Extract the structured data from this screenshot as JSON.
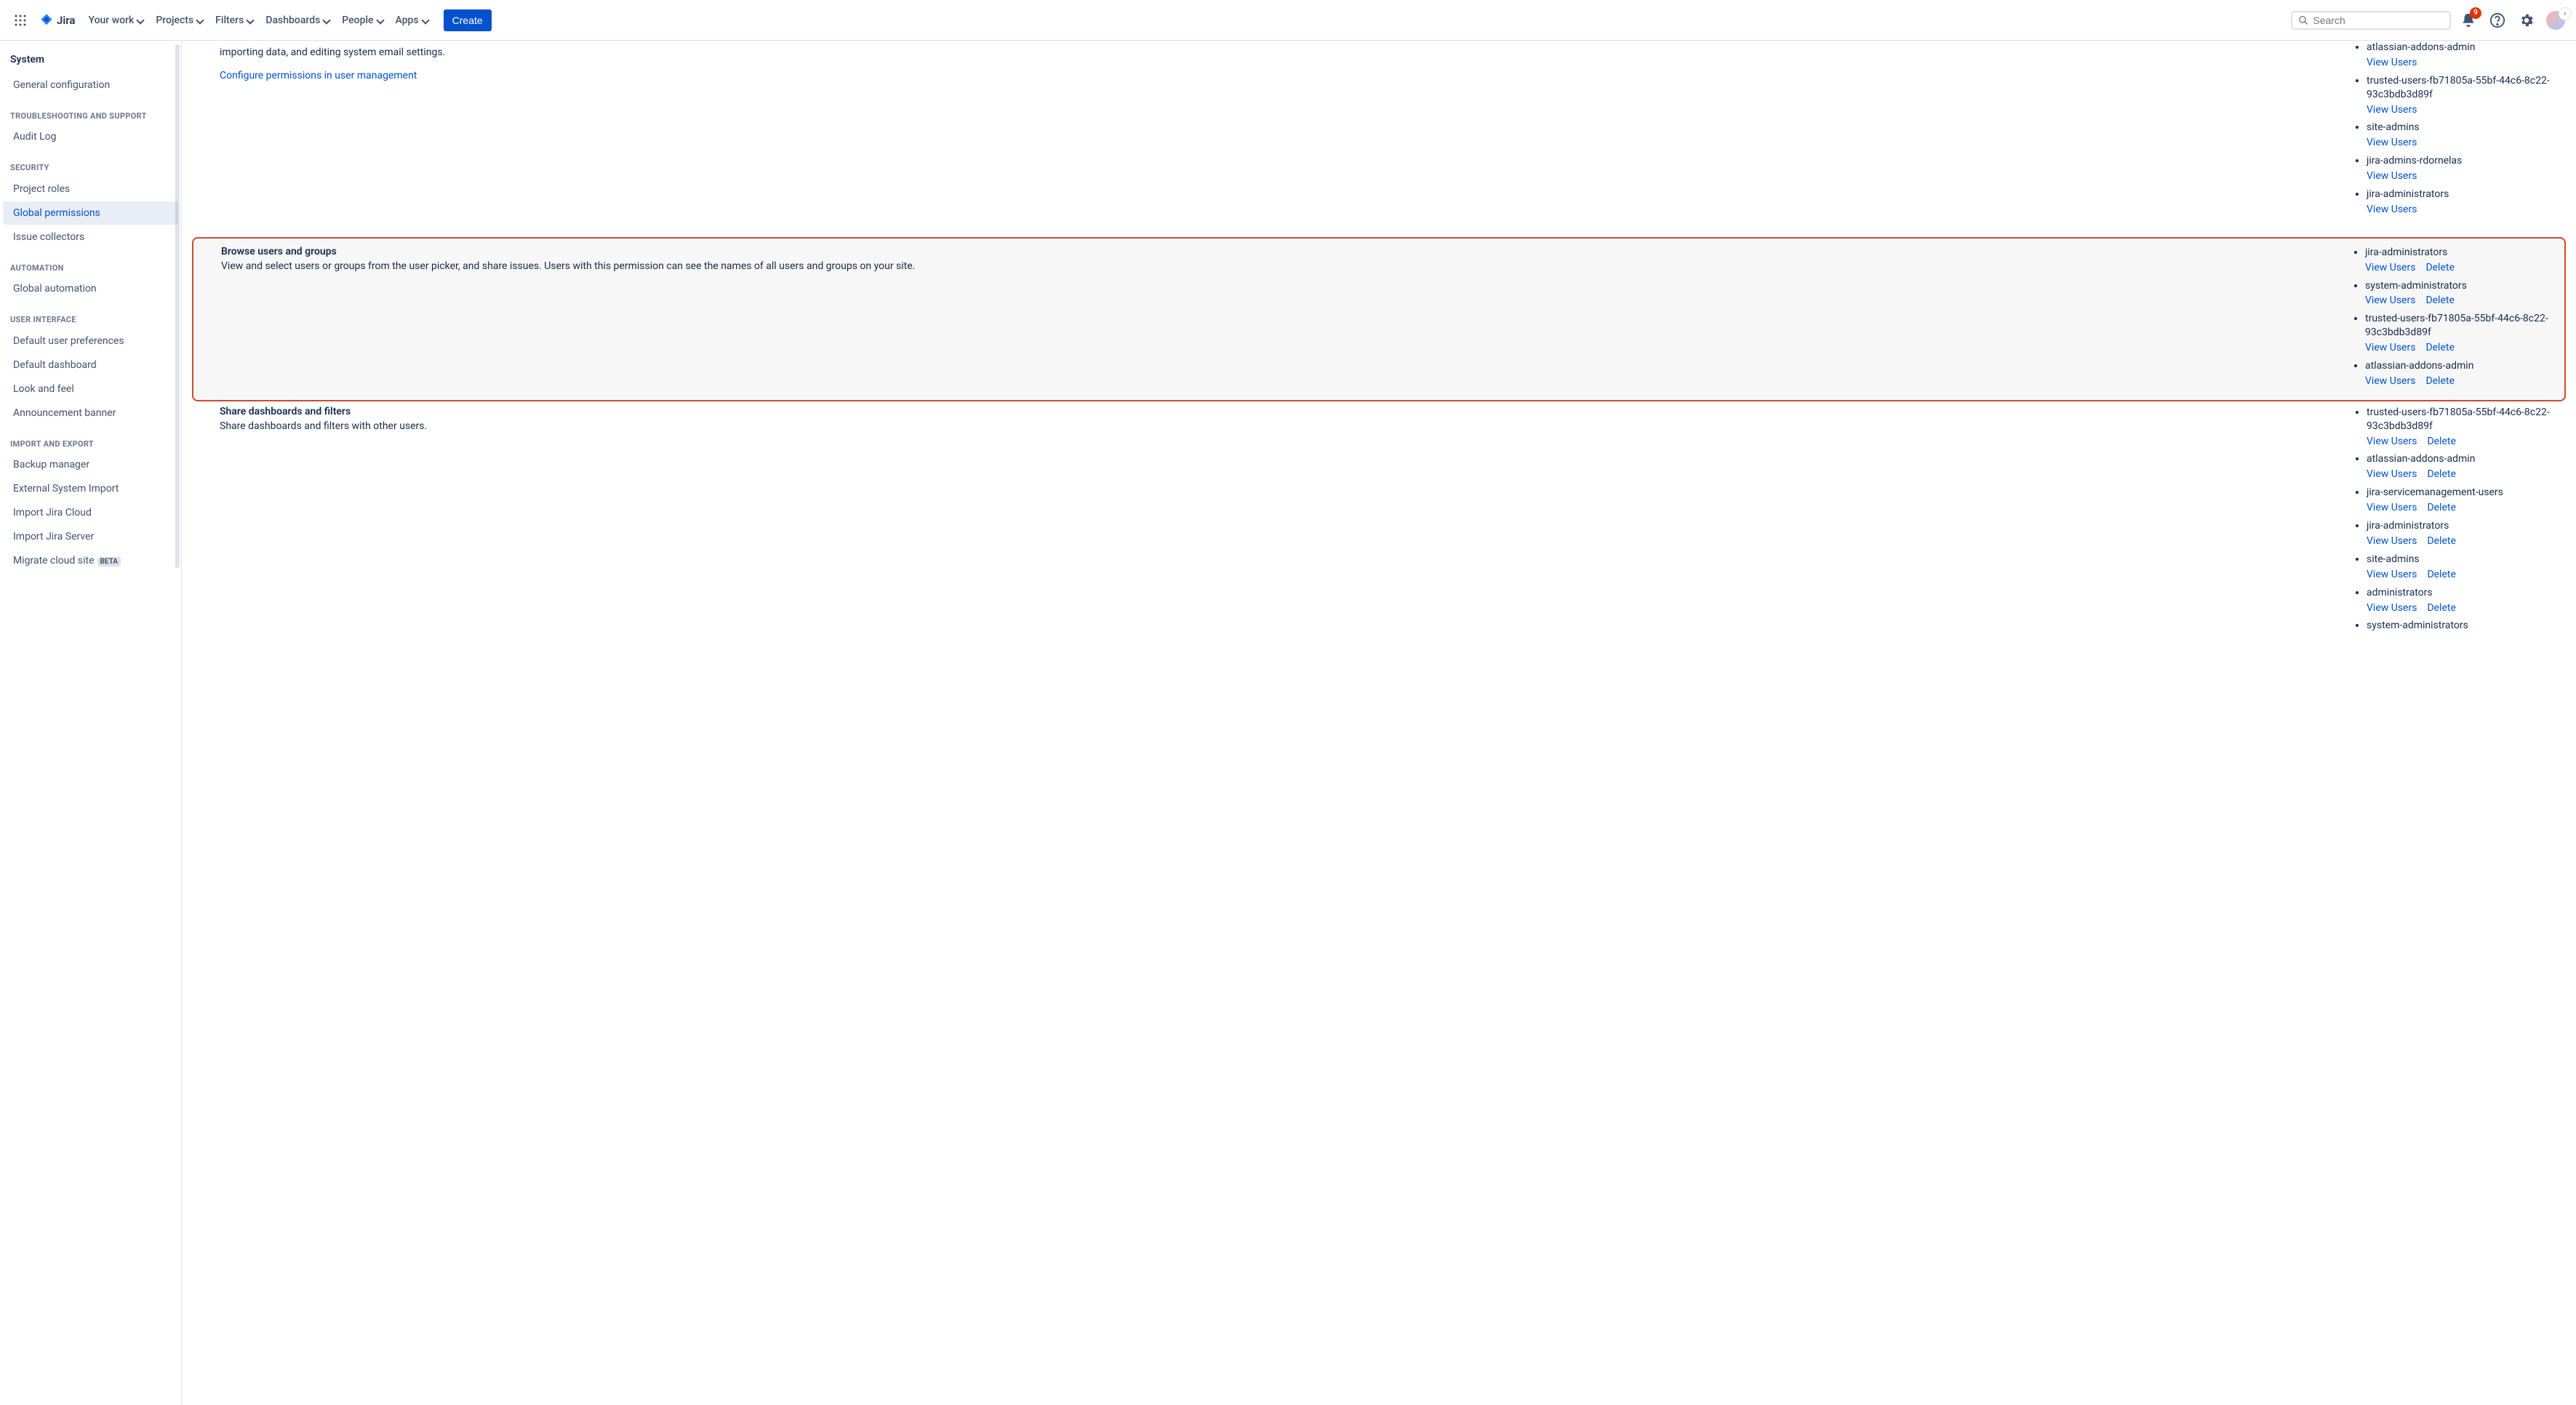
{
  "nav": {
    "product": "Jira",
    "items": [
      "Your work",
      "Projects",
      "Filters",
      "Dashboards",
      "People",
      "Apps"
    ],
    "create": "Create",
    "search_placeholder": "Search",
    "notification_count": "9"
  },
  "sidebar": {
    "title": "System",
    "groups": [
      {
        "header": null,
        "items": [
          {
            "label": "General configuration"
          }
        ]
      },
      {
        "header": "TROUBLESHOOTING AND SUPPORT",
        "items": [
          {
            "label": "Audit Log"
          }
        ]
      },
      {
        "header": "SECURITY",
        "items": [
          {
            "label": "Project roles"
          },
          {
            "label": "Global permissions",
            "active": true
          },
          {
            "label": "Issue collectors"
          }
        ]
      },
      {
        "header": "AUTOMATION",
        "items": [
          {
            "label": "Global automation"
          }
        ]
      },
      {
        "header": "USER INTERFACE",
        "items": [
          {
            "label": "Default user preferences"
          },
          {
            "label": "Default dashboard"
          },
          {
            "label": "Look and feel"
          },
          {
            "label": "Announcement banner"
          }
        ]
      },
      {
        "header": "IMPORT AND EXPORT",
        "items": [
          {
            "label": "Backup manager"
          },
          {
            "label": "External System Import"
          },
          {
            "label": "Import Jira Cloud"
          },
          {
            "label": "Import Jira Server"
          },
          {
            "label": "Migrate cloud site",
            "beta": "BETA"
          }
        ]
      }
    ]
  },
  "labels": {
    "view_users": "View Users",
    "delete": "Delete"
  },
  "permissions": [
    {
      "title": "",
      "desc": "importing data, and editing system email settings.",
      "link": "Configure permissions in user management",
      "highlighted": false,
      "partial_top": true,
      "groups": [
        {
          "name": "atlassian-addons-admin",
          "actions": [
            "view"
          ]
        },
        {
          "name": "trusted-users-fb71805a-55bf-44c6-8c22-93c3bdb3d89f",
          "actions": [
            "view"
          ]
        },
        {
          "name": "site-admins",
          "actions": [
            "view"
          ]
        },
        {
          "name": "jira-admins-rdornelas",
          "actions": [
            "view"
          ]
        },
        {
          "name": "jira-administrators",
          "actions": [
            "view"
          ]
        }
      ]
    },
    {
      "title": "Browse users and groups",
      "desc": "View and select users or groups from the user picker, and share issues. Users with this permission can see the names of all users and groups on your site.",
      "highlighted": true,
      "groups": [
        {
          "name": "jira-administrators",
          "actions": [
            "view",
            "delete"
          ]
        },
        {
          "name": "system-administrators",
          "actions": [
            "view",
            "delete"
          ]
        },
        {
          "name": "trusted-users-fb71805a-55bf-44c6-8c22-93c3bdb3d89f",
          "actions": [
            "view",
            "delete"
          ]
        },
        {
          "name": "atlassian-addons-admin",
          "actions": [
            "view",
            "delete"
          ]
        }
      ]
    },
    {
      "title": "Share dashboards and filters",
      "desc": "Share dashboards and filters with other users.",
      "highlighted": false,
      "groups": [
        {
          "name": "trusted-users-fb71805a-55bf-44c6-8c22-93c3bdb3d89f",
          "actions": [
            "view",
            "delete"
          ]
        },
        {
          "name": "atlassian-addons-admin",
          "actions": [
            "view",
            "delete"
          ]
        },
        {
          "name": "jira-servicemanagement-users",
          "actions": [
            "view",
            "delete"
          ]
        },
        {
          "name": "jira-administrators",
          "actions": [
            "view",
            "delete"
          ]
        },
        {
          "name": "site-admins",
          "actions": [
            "view",
            "delete"
          ]
        },
        {
          "name": "administrators",
          "actions": [
            "view",
            "delete"
          ]
        },
        {
          "name": "system-administrators",
          "actions": []
        }
      ]
    }
  ]
}
